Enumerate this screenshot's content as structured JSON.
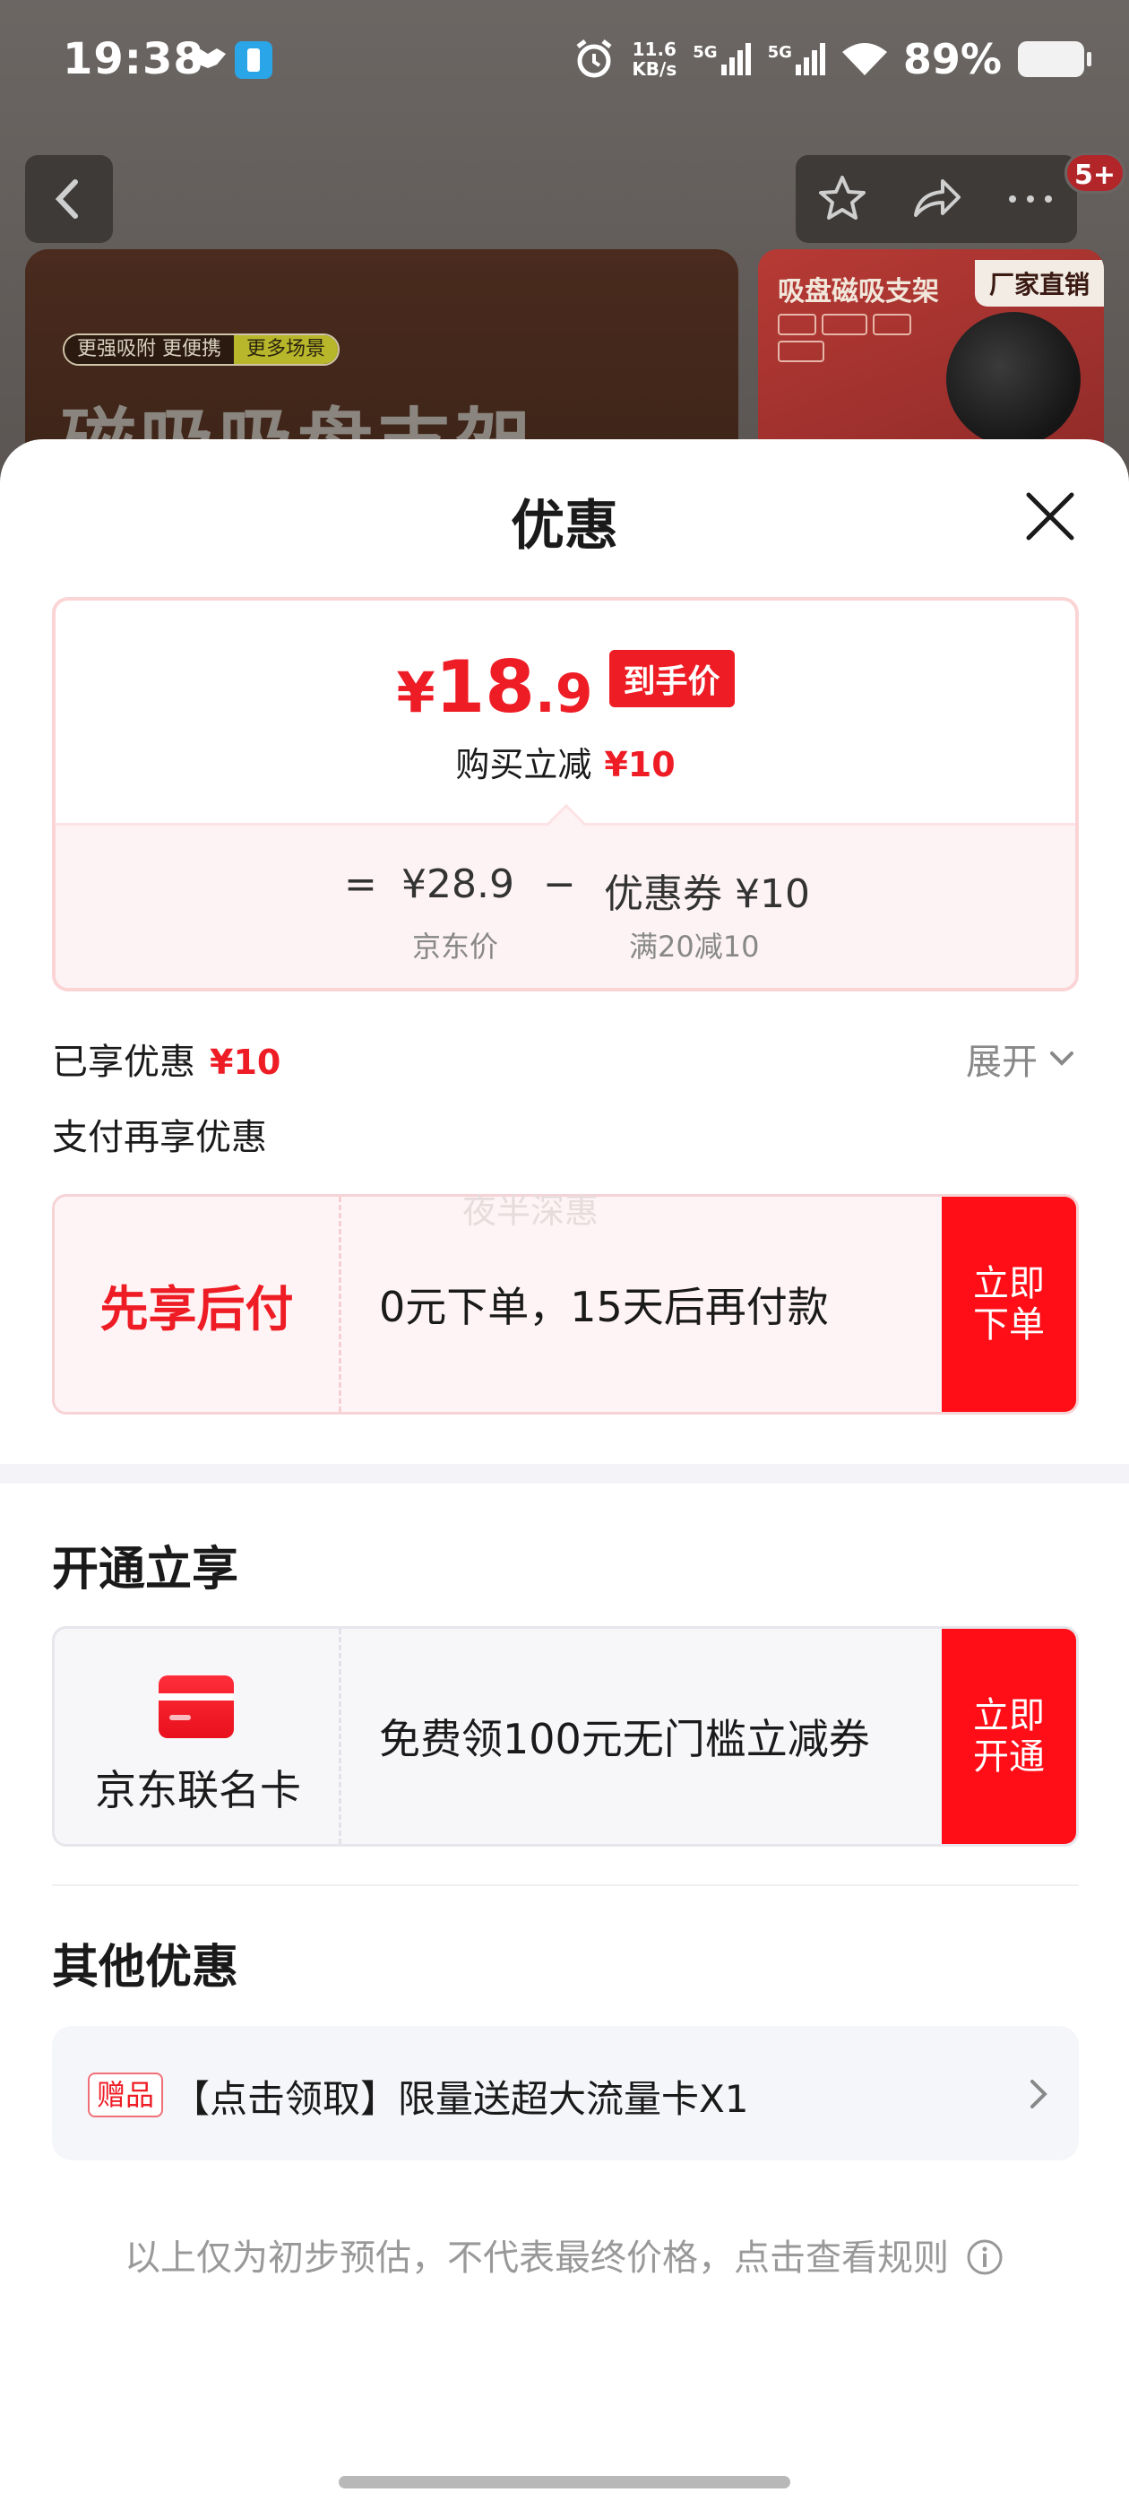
{
  "status_bar": {
    "time": "19:38",
    "net_speed_value": "11.6",
    "net_speed_unit": "KB/s",
    "signal1": "5G",
    "signal2": "5G",
    "battery": "89%"
  },
  "background_page": {
    "notification_badge": "5+",
    "hero_tag_1": "更强吸附 更便携",
    "hero_tag_2": "更多场景",
    "hero_title": "磁吸吸盘支架",
    "thumb_title": "吸盘磁吸支架",
    "thumb_tag": "厂家直销",
    "icons": [
      "back-icon",
      "star-icon",
      "share-icon",
      "more-icon"
    ]
  },
  "sheet": {
    "title": "优惠",
    "price_card": {
      "currency": "¥",
      "price_int": "18",
      "price_dec": ".9",
      "price_tag": "到手价",
      "reduce_label": "购买立减",
      "reduce_value": "¥10",
      "equals": "=",
      "base_price": "¥28.9",
      "minus": "−",
      "coupon_value": "优惠券 ¥10",
      "base_label": "京东价",
      "coupon_label": "满20减10"
    },
    "enjoyed_label": "已享优惠",
    "enjoyed_value": "¥10",
    "expand_label": "展开",
    "pay_section_label": "支付再享优惠",
    "pay_card": {
      "title": "先享后付",
      "desc": "0元下单，15天后再付款",
      "button": "立即\n下单",
      "watermark": "夜半深惠"
    },
    "open_section_title": "开通立享",
    "card_offer": {
      "name": "京东联名卡",
      "desc": "免费领100元无门槛立减券",
      "button": "立即\n开通"
    },
    "other_section_title": "其他优惠",
    "gift": {
      "tag": "赠品",
      "text": "【点击领取】限量送超大流量卡X1"
    },
    "footnote": "以上仅为初步预估，不代表最终价格，点击查看规则"
  },
  "colors": {
    "accent_red": "#ee1c25",
    "button_red": "#ff0e18",
    "overlay": "#5d5754"
  }
}
